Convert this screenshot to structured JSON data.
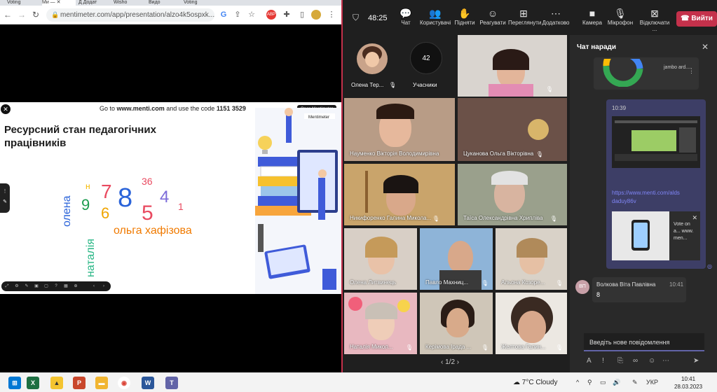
{
  "browser": {
    "tabs": [
      "Voting",
      "Ми — ✕",
      "Д Додат",
      "Wisho",
      "Видо",
      "Voting"
    ],
    "url": "mentimeter.com/app/presentation/alzo4k5ospxk..."
  },
  "slide": {
    "join_prefix": "Go to",
    "join_site": "www.menti.com",
    "join_middle": "and use the code",
    "join_code": "1151 3529",
    "open_button": "Open Mentimeter",
    "brand": "Mentimeter",
    "title": "Ресурсний стан педагогічних працівників",
    "words": [
      {
        "text": "олена",
        "color": "#2a63d9"
      },
      {
        "text": "н",
        "color": "#f5b800"
      },
      {
        "text": "9",
        "color": "#1c9c4f"
      },
      {
        "text": "7",
        "color": "#e94a60"
      },
      {
        "text": "6",
        "color": "#f0a500"
      },
      {
        "text": "8",
        "color": "#2a63d9"
      },
      {
        "text": "36",
        "color": "#e94a60"
      },
      {
        "text": "4",
        "color": "#7c6bd9"
      },
      {
        "text": "5",
        "color": "#e94a60"
      },
      {
        "text": "1",
        "color": "#e94a60"
      },
      {
        "text": "ольга хафізова",
        "color": "#f07a00"
      },
      {
        "text": "наталія",
        "color": "#25b583"
      }
    ]
  },
  "teams": {
    "timer": "48:25",
    "toolbar": [
      {
        "label": "Чат",
        "icon": "chat-icon",
        "glyph": "💬"
      },
      {
        "label": "Користувачі",
        "icon": "people-icon",
        "glyph": "👥"
      },
      {
        "label": "Підняти",
        "icon": "raise-hand-icon",
        "glyph": "✋"
      },
      {
        "label": "Реагувати",
        "icon": "react-icon",
        "glyph": "☺"
      },
      {
        "label": "Переглянути",
        "icon": "view-icon",
        "glyph": "⊞"
      },
      {
        "label": "Додатково",
        "icon": "more-icon",
        "glyph": "⋯"
      },
      {
        "label": "Камера",
        "icon": "camera-icon",
        "glyph": "■"
      },
      {
        "label": "Мікрофон",
        "icon": "mic-icon",
        "glyph": "🎙"
      },
      {
        "label": "Відключати ...",
        "icon": "share-icon",
        "glyph": "⊠"
      }
    ],
    "leave_label": "Вийти",
    "participants": {
      "olena_ter": "Олена Тер...",
      "count": "42",
      "count_label": "Учасники",
      "tiles": [
        "Науменко Вікторія Володимирівна",
        "Цуканова Ольга Вікторівна",
        "Никифоренко Галина Микола...",
        "Таїса Олександрівна Хрипліва",
        "Олена Литвинець",
        "Павло Махниц...",
        "Альона Козоре...",
        "Наталія Микол...",
        "Керімова Ірада ...",
        "Желтова Галин..."
      ]
    },
    "pager": "1/2",
    "chat": {
      "title": "Чат наради",
      "file_name": "jambo ard....",
      "time": "10:39",
      "link": "https://www.menti.com/alds daduy86v",
      "preview": "Vote on a... www. men...",
      "sender_initials": "ВП",
      "sender": "Волкова Віта Павлівна",
      "sender_time": "10:41",
      "message": "8",
      "placeholder": "Введіть нове повідомлення"
    }
  },
  "taskbar": {
    "weather": "7°C Cloudy",
    "lang": "УКР",
    "time": "10:41",
    "date": "28.03.2023"
  }
}
